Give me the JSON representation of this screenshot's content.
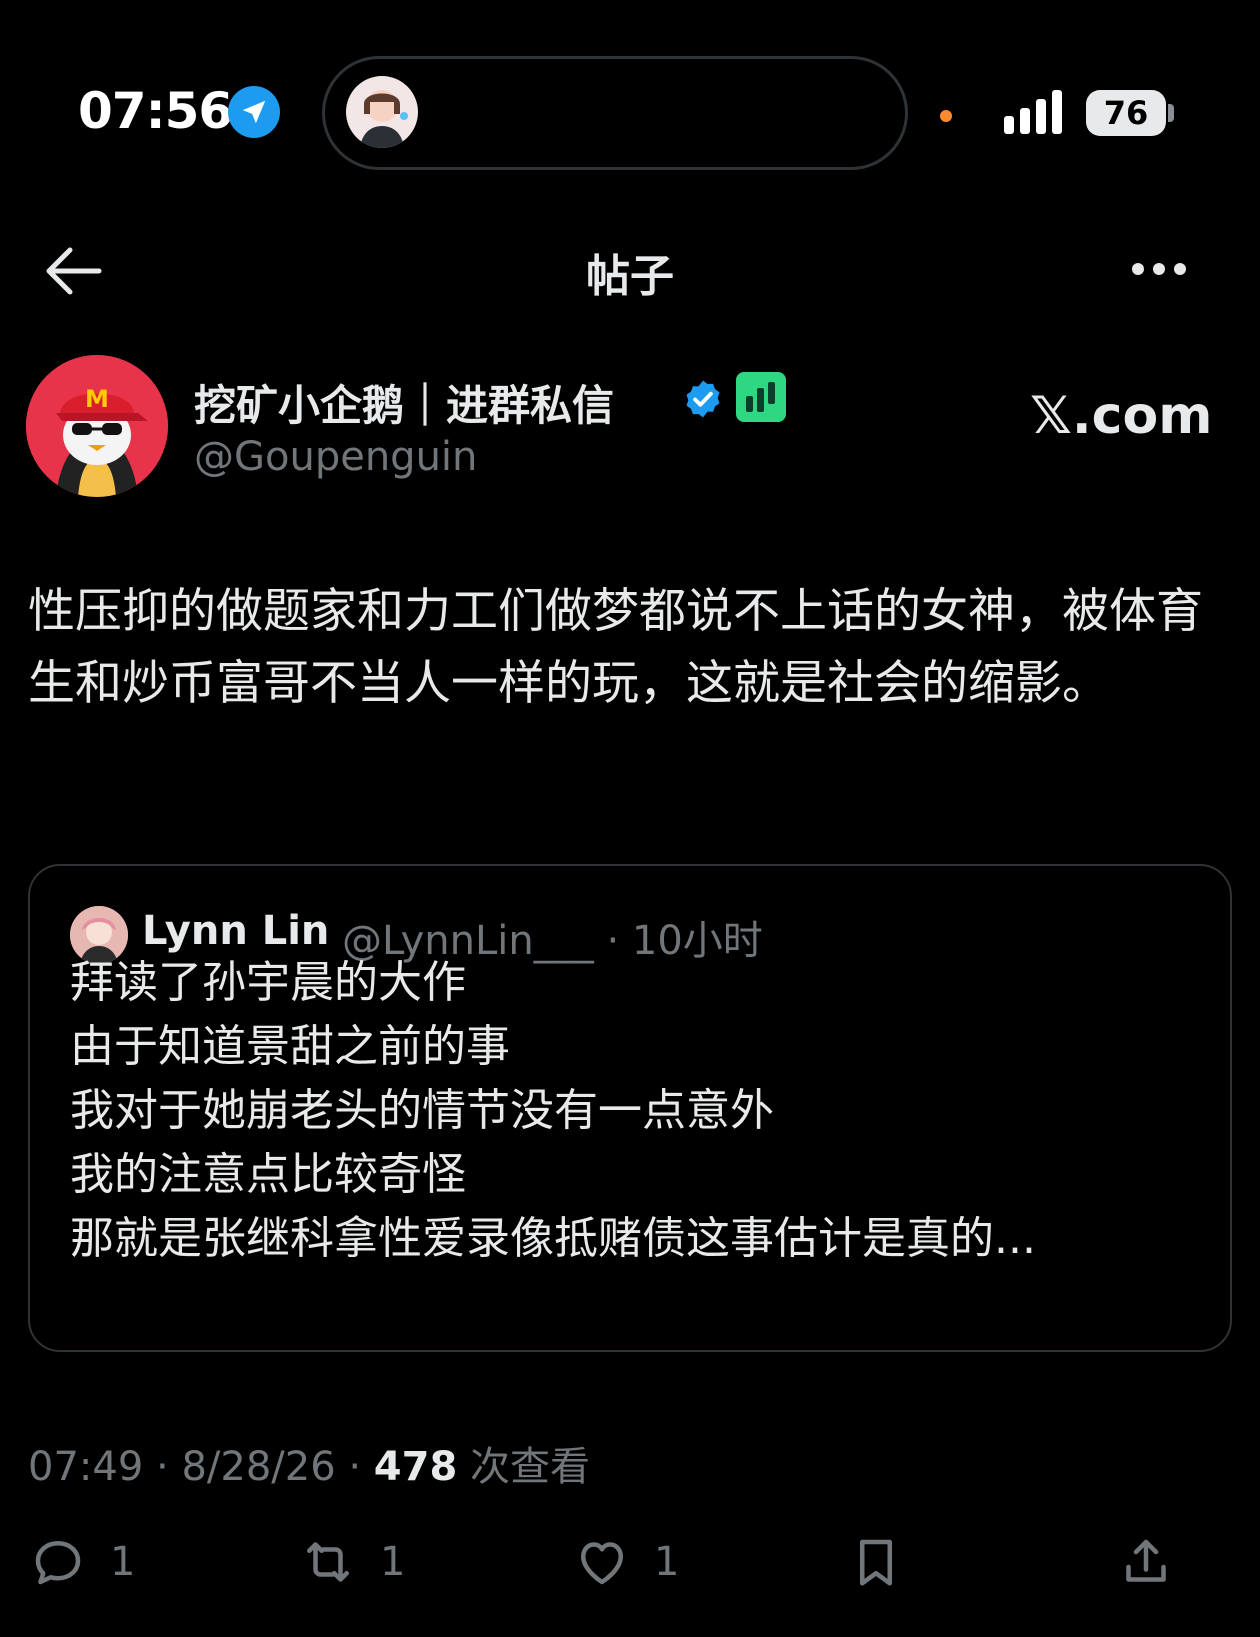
{
  "status_bar": {
    "time": "07:56",
    "battery": "76"
  },
  "header": {
    "title": "帖子"
  },
  "author": {
    "name": "挖矿小企鹅｜进群私信",
    "handle": "@Goupenguin",
    "source_label": "𝕏.com"
  },
  "post": {
    "text": "性压抑的做题家和力工们做梦都说不上话的女神，被体育生和炒币富哥不当人一样的玩，这就是社会的缩影。"
  },
  "quoted": {
    "name": "Lynn Lin",
    "handle": "@LynnLin___",
    "time": "· 10小时",
    "lines": [
      "拜读了孙宇晨的大作",
      "由于知道景甜之前的事",
      "我对于她崩老头的情节没有一点意外",
      "我的注意点比较奇怪",
      "那就是张继科拿性爱录像抵赌债这事估计是真的..."
    ]
  },
  "meta": {
    "time": "07:49",
    "date": "8/28/26",
    "views": "478",
    "views_label": "次查看"
  },
  "actions": {
    "replies": "1",
    "reposts": "1",
    "likes": "1"
  },
  "colors": {
    "accent": "#1d9bf0",
    "muted": "#71767b",
    "brand_badge": "#2ed882",
    "avatar_bg": "#e8344a"
  }
}
